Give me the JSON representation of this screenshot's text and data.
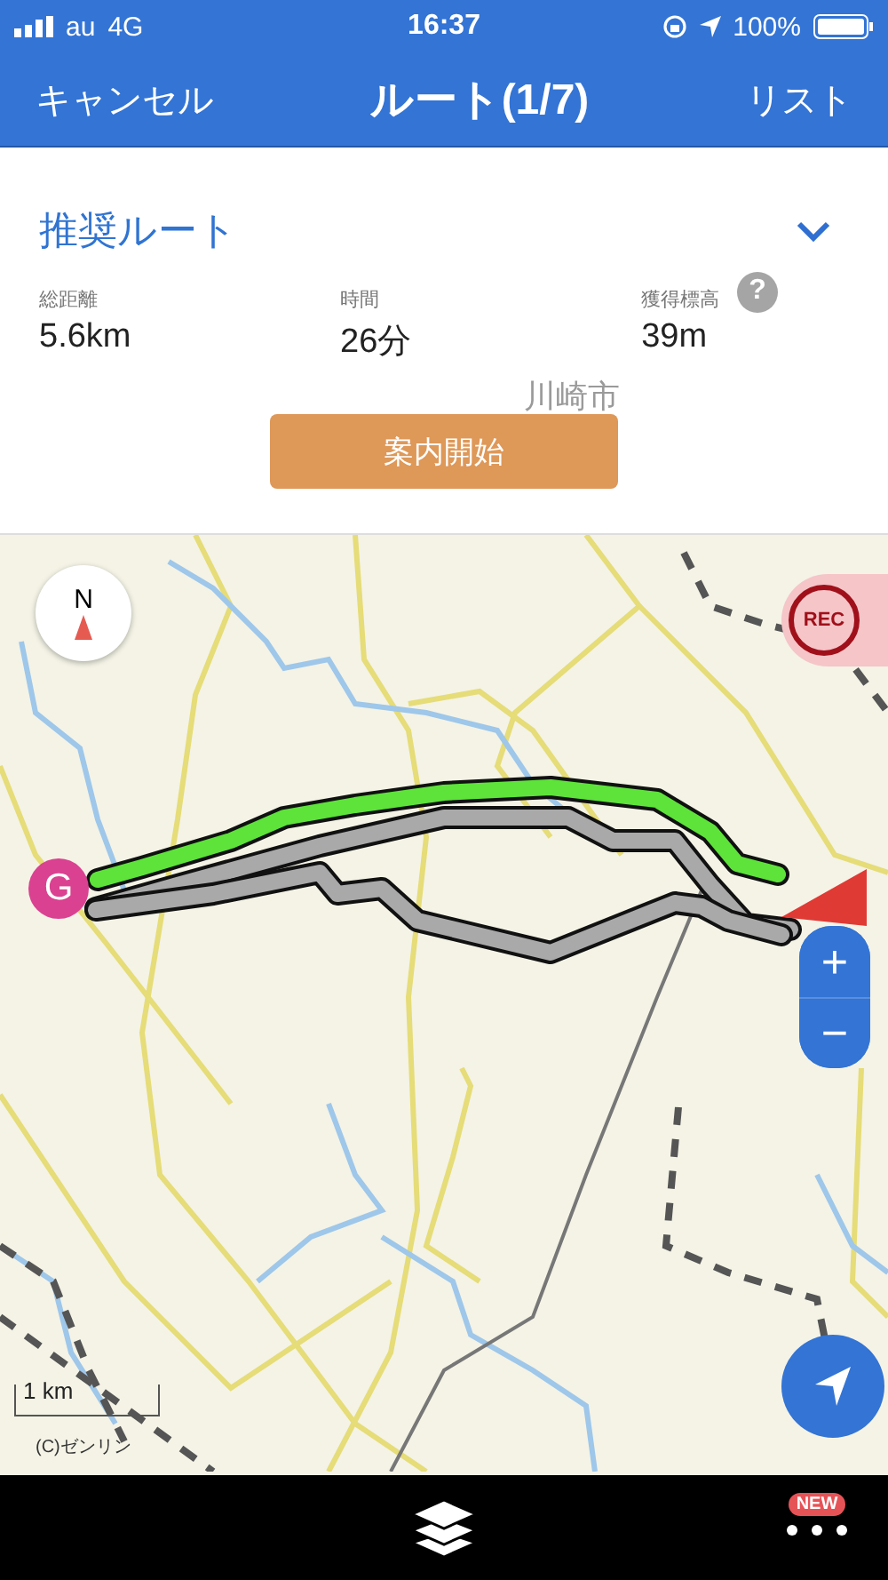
{
  "status_bar": {
    "carrier": "au",
    "network": "4G",
    "time": "16:37",
    "battery": "100%"
  },
  "nav": {
    "cancel": "キャンセル",
    "title": "ルート(1/7)",
    "list": "リスト"
  },
  "route": {
    "name": "推奨ルート",
    "start_button": "案内開始"
  },
  "stats": [
    {
      "label": "総距離",
      "value": "5.6km"
    },
    {
      "label": "時間",
      "value": "26分"
    },
    {
      "label": "獲得標高",
      "value": "39m",
      "help_icon": "?"
    }
  ],
  "map": {
    "area_label": "川崎市",
    "compass": "N",
    "goal_marker": "G",
    "rec_button": "REC",
    "zoom_in": "+",
    "zoom_out": "−",
    "scale": "1 km",
    "copyright": "(C)ゼンリン",
    "routes": [
      {
        "selected": false
      },
      {
        "selected": false
      },
      {
        "selected": true
      }
    ]
  },
  "bottom_bar": {
    "badge": "NEW"
  }
}
